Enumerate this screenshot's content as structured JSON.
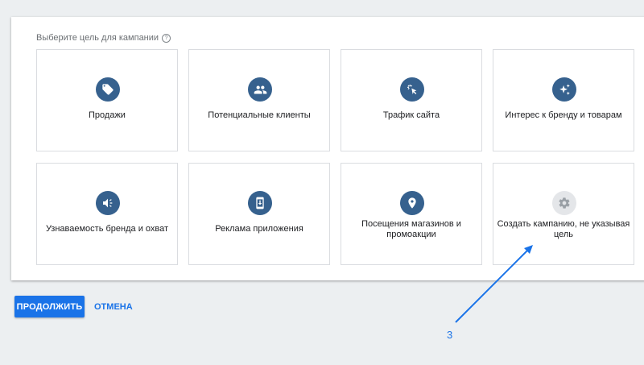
{
  "prompt": "Выберите цель для кампании",
  "goals": [
    {
      "label": "Продажи",
      "icon": "tag-icon"
    },
    {
      "label": "Потенциальные клиенты",
      "icon": "people-icon"
    },
    {
      "label": "Трафик сайта",
      "icon": "cursor-click-icon"
    },
    {
      "label": "Интерес к бренду и товарам",
      "icon": "sparkle-icon"
    },
    {
      "label": "Узнаваемость бренда и охват",
      "icon": "megaphone-icon"
    },
    {
      "label": "Реклама приложения",
      "icon": "phone-download-icon"
    },
    {
      "label": "Посещения магазинов и промоакции",
      "icon": "location-pin-icon"
    },
    {
      "label": "Создать кампанию, не указывая цель",
      "icon": "gear-icon"
    }
  ],
  "buttons": {
    "continue": "ПРОДОЛЖИТЬ",
    "cancel": "ОТМЕНА"
  },
  "annotation": "3",
  "colors": {
    "icon_bg": "#36618e",
    "icon_bg_disabled": "#e4e6e9",
    "accent": "#1a73e8"
  }
}
